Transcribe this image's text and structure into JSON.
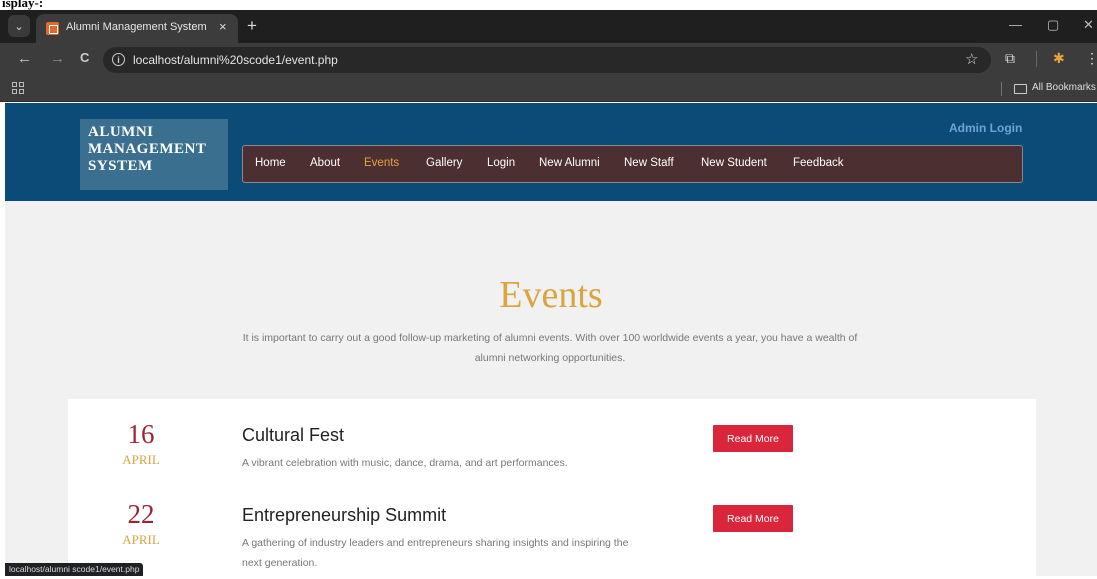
{
  "caption": "isplay-:",
  "browser": {
    "tab_title": "Alumni Management System",
    "tab_close": "×",
    "new_tab": "+",
    "url": "localhost/alumni%20scode1/event.php",
    "bookmarks_label": "All Bookmarks",
    "status_url": "localhost/alumni scode1/event.php",
    "back": "←",
    "forward": "→",
    "reload": "C",
    "minimize": "—",
    "restore": "▢",
    "close": "✕",
    "menu": "⋮",
    "tab_menu": "⌄"
  },
  "site": {
    "logo_lines": [
      "ALUMNI",
      "MANAGEMENT",
      "SYSTEM"
    ],
    "admin_login": "Admin Login",
    "nav": [
      "Home",
      "About",
      "Events",
      "Gallery",
      "Login",
      "New Alumni",
      "New Staff",
      "New Student",
      "Feedback"
    ],
    "active_nav": "Events",
    "accent_color": "#d9a441",
    "header_color": "#0c4b78"
  },
  "events_page": {
    "title": "Events",
    "intro": "It is important to carry out a good follow-up marketing of alumni events. With over 100 worldwide events a year, you have a wealth of alumni networking opportunities.",
    "events": [
      {
        "day": "16",
        "month": "APRIL",
        "title": "Cultural Fest",
        "desc": "A vibrant celebration with music, dance, drama, and art performances.",
        "button": "Read More"
      },
      {
        "day": "22",
        "month": "APRIL",
        "title": "Entrepreneurship Summit",
        "desc": "A gathering of industry leaders and entrepreneurs sharing insights and inspiring the next generation.",
        "button": "Read More"
      }
    ]
  }
}
